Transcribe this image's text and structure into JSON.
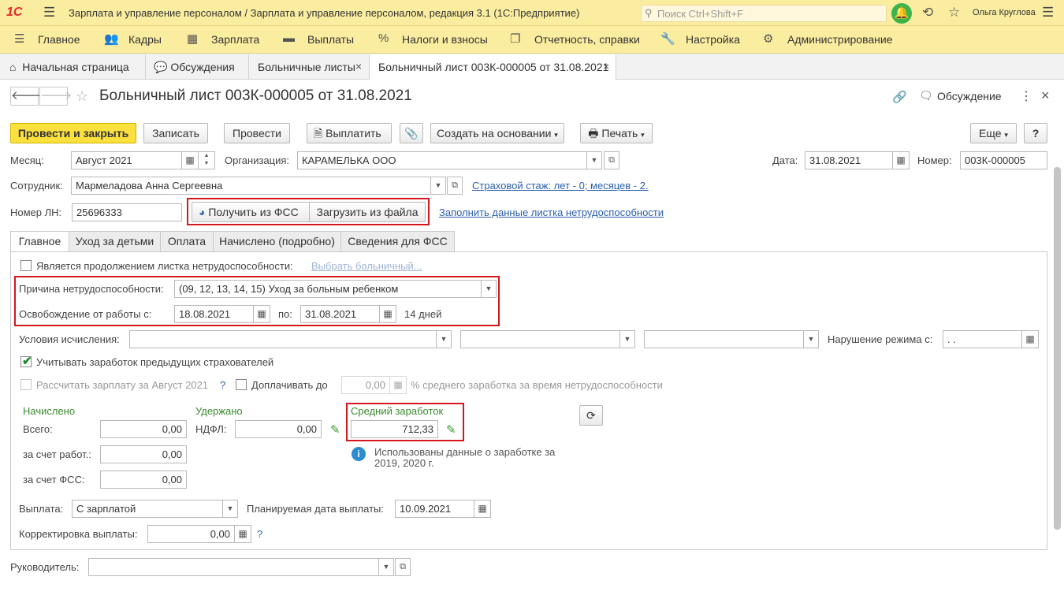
{
  "app": {
    "logo": "1С",
    "title": "Зарплата и управление персоналом / Зарплата и управление персоналом, редакция 3.1  (1С:Предприятие)",
    "search_placeholder": "Поиск Ctrl+Shift+F",
    "user": "Ольга Круглова"
  },
  "menu": [
    "Главное",
    "Кадры",
    "Зарплата",
    "Выплаты",
    "Налоги и взносы",
    "Отчетность, справки",
    "Настройка",
    "Администрирование"
  ],
  "tabs": [
    "Начальная страница",
    "Обсуждения",
    "Больничные листы",
    "Больничный лист 003К-000005 от 31.08.2021"
  ],
  "doc": {
    "title": "Больничный лист 003К-000005 от 31.08.2021",
    "discussion": "Обсуждение"
  },
  "toolbar": {
    "post_close": "Провести и закрыть",
    "save": "Записать",
    "post": "Провести",
    "pay": "Выплатить",
    "create_based": "Создать на основании",
    "print": "Печать",
    "more": "Еще",
    "help": "?"
  },
  "header": {
    "month_label": "Месяц:",
    "month_value": "Август 2021",
    "org_label": "Организация:",
    "org_value": "КАРАМЕЛЬКА ООО",
    "date_label": "Дата:",
    "date_value": "31.08.2021",
    "number_label": "Номер:",
    "number_value": "003К-000005",
    "employee_label": "Сотрудник:",
    "employee_value": "Мармеладова Анна Сергеевна",
    "insurance_link": "Страховой стаж: лет - 0; месяцев - 2.",
    "ln_label": "Номер ЛН:",
    "ln_value": "25696333",
    "get_fss": "Получить из ФСС",
    "load_file": "Загрузить из файла",
    "fill_link": "Заполнить данные листка нетрудоспособности"
  },
  "form_tabs": [
    "Главное",
    "Уход за детьми",
    "Оплата",
    "Начислено (подробно)",
    "Сведения для ФСС"
  ],
  "main": {
    "continuation_label": "Является продолжением листка нетрудоспособности:",
    "choose_link": "Выбрать больничный...",
    "reason_label": "Причина нетрудоспособности:",
    "reason_value": "(09, 12, 13, 14, 15) Уход за больным ребенком",
    "release_label": "Освобождение от работы с:",
    "release_from": "18.08.2021",
    "to_label": "по:",
    "release_to": "31.08.2021",
    "days": "14 дней",
    "conditions_label": "Условия исчисления:",
    "violation_label": "Нарушение режима с:",
    "violation_value": " .  .",
    "consider_prev": "Учитывать заработок предыдущих страхователей",
    "calc_salary": "Рассчитать зарплату за Август 2021",
    "q": "?",
    "top_up": "Доплачивать до",
    "top_up_value": "0,00",
    "top_up_suffix": "% среднего заработка за время нетрудоспособности",
    "accrued_head": "Начислено",
    "total_label": "Всего:",
    "total_value": "0,00",
    "employer_label": "за счет работ.:",
    "employer_value": "0,00",
    "fss_label": "за счет ФСС:",
    "fss_value": "0,00",
    "withheld_head": "Удержано",
    "ndfl_label": "НДФЛ:",
    "ndfl_value": "0,00",
    "avg_head": "Средний заработок",
    "avg_value": "712,33",
    "info_text_1": "Использованы данные о заработке за",
    "info_text_2": "2019,  2020 г.",
    "payment_label": "Выплата:",
    "payment_value": "С зарплатой",
    "planned_label": "Планируемая дата выплаты:",
    "planned_value": "10.09.2021",
    "correction_label": "Корректировка выплаты:",
    "correction_value": "0,00"
  },
  "footer": {
    "manager_label": "Руководитель:"
  }
}
